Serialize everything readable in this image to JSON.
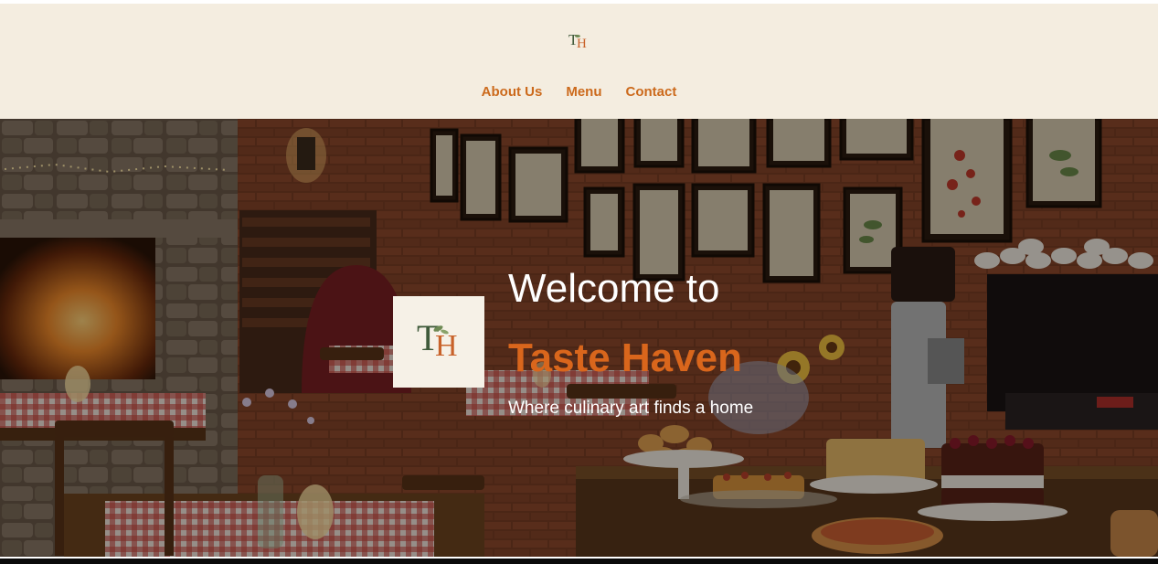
{
  "header": {
    "logo": {
      "t": "T",
      "h": "H"
    },
    "nav": [
      {
        "label": "About Us"
      },
      {
        "label": "Menu"
      },
      {
        "label": "Contact"
      }
    ]
  },
  "hero": {
    "logo": {
      "t": "T",
      "h": "H"
    },
    "welcome": "Welcome to",
    "brand": "Taste Haven",
    "tagline": "Where culinary art finds a home"
  },
  "colors": {
    "header_bg": "#f4ede0",
    "nav_link": "#cc6a1c",
    "brand_accent": "#d9661c",
    "logo_green": "#3f5a3a",
    "logo_orange": "#c8622a"
  }
}
